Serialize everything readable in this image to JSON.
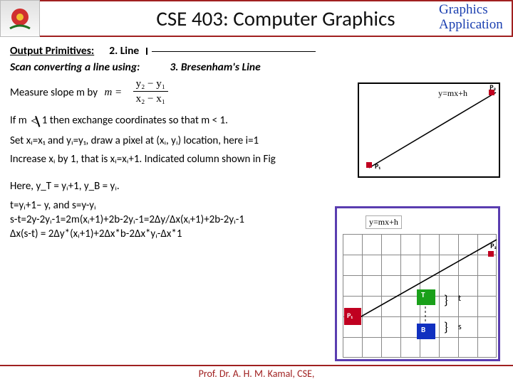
{
  "header": {
    "course_title": "CSE 403: Computer Graphics",
    "tag_line1": "Graphics",
    "tag_line2": "Application"
  },
  "section": {
    "label": "Output Primitives:",
    "item_no": "2. Line",
    "subtitle": "Scan converting a line using:",
    "method": "3. Bresenham's Line"
  },
  "body": {
    "p1_pre": "Measure slope m by",
    "m_label": "m =",
    "frac_num": "y₂ − y₁",
    "frac_den": "x₂ − x₁",
    "p2_pre": "If m",
    "p2_post": " 1  then exchange coordinates so that m < 1.",
    "p3": "Set xᵢ=x₁ and yᵢ=y₁, draw a pixel at (xᵢ, yᵢ) location, here i=1",
    "p4": "Increase xᵢ by 1, that is xᵢ=xᵢ+1. Indicated column shown in Fig",
    "p5": "Here, y_T = yᵢ+1, y_B = yᵢ.",
    "p6": "t=yᵢ+1– y, and s=y-yᵢ",
    "p7": "s-t=2y-2yᵢ-1=2m(xᵢ+1)+2b-2yᵢ-1=2Δy/Δx(xᵢ+1)+2b-2yᵢ-1",
    "p8": "Δx(s-t) = 2Δy*(xᵢ+1)+2Δx*b-2Δx*yᵢ-Δx*1"
  },
  "fig1": {
    "eq": "y=mx+h",
    "p1": "P₁",
    "p2": "P₂"
  },
  "fig2": {
    "eq": "y=mx+h",
    "p1": "P₁",
    "p2": "P₂",
    "T": "T",
    "B": "B",
    "t": "t",
    "s": "s"
  },
  "footer": "Prof. Dr. A. H. M. Kamal, CSE,"
}
